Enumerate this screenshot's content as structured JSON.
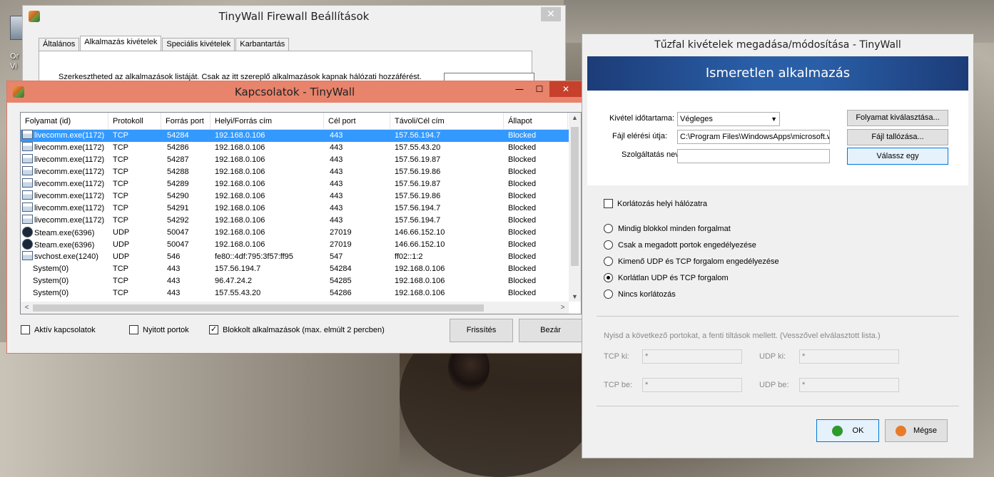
{
  "desktop": {
    "icon_label_line1": "Or",
    "icon_label_line2": "Vi"
  },
  "settings": {
    "title": "TinyWall Firewall Beállítások",
    "close": "✕",
    "tabs": [
      "Általános",
      "Alkalmazás kivételek",
      "Speciális kivételek",
      "Karbantartás"
    ],
    "description": "Szerkesztheted az alkalmazások listáját. Csak az itt szereplő alkalmazások kapnak hálózati hozzáférést."
  },
  "connections": {
    "title": "Kapcsolatok - TinyWall",
    "controls": {
      "minimize": "—",
      "maximize": "☐",
      "close": "✕"
    },
    "columns": [
      "Folyamat (id)",
      "Protokoll",
      "Forrás port",
      "Helyi/Forrás cím",
      "Cél port",
      "Távoli/Cél cím",
      "Állapot"
    ],
    "rows": [
      {
        "icon": "process-icon",
        "proc": "livecomm.exe(1172)",
        "proto": "TCP",
        "src_port": "54284",
        "local": "192.168.0.106",
        "dst_port": "443",
        "remote": "157.56.194.7",
        "state": "Blocked",
        "selected": true
      },
      {
        "icon": "process-icon",
        "proc": "livecomm.exe(1172)",
        "proto": "TCP",
        "src_port": "54286",
        "local": "192.168.0.106",
        "dst_port": "443",
        "remote": "157.55.43.20",
        "state": "Blocked"
      },
      {
        "icon": "process-icon",
        "proc": "livecomm.exe(1172)",
        "proto": "TCP",
        "src_port": "54287",
        "local": "192.168.0.106",
        "dst_port": "443",
        "remote": "157.56.19.87",
        "state": "Blocked"
      },
      {
        "icon": "process-icon",
        "proc": "livecomm.exe(1172)",
        "proto": "TCP",
        "src_port": "54288",
        "local": "192.168.0.106",
        "dst_port": "443",
        "remote": "157.56.19.86",
        "state": "Blocked"
      },
      {
        "icon": "process-icon",
        "proc": "livecomm.exe(1172)",
        "proto": "TCP",
        "src_port": "54289",
        "local": "192.168.0.106",
        "dst_port": "443",
        "remote": "157.56.19.87",
        "state": "Blocked"
      },
      {
        "icon": "process-icon",
        "proc": "livecomm.exe(1172)",
        "proto": "TCP",
        "src_port": "54290",
        "local": "192.168.0.106",
        "dst_port": "443",
        "remote": "157.56.19.86",
        "state": "Blocked"
      },
      {
        "icon": "process-icon",
        "proc": "livecomm.exe(1172)",
        "proto": "TCP",
        "src_port": "54291",
        "local": "192.168.0.106",
        "dst_port": "443",
        "remote": "157.56.194.7",
        "state": "Blocked"
      },
      {
        "icon": "process-icon",
        "proc": "livecomm.exe(1172)",
        "proto": "TCP",
        "src_port": "54292",
        "local": "192.168.0.106",
        "dst_port": "443",
        "remote": "157.56.194.7",
        "state": "Blocked"
      },
      {
        "icon": "steam-icon",
        "proc": "Steam.exe(6396)",
        "proto": "UDP",
        "src_port": "50047",
        "local": "192.168.0.106",
        "dst_port": "27019",
        "remote": "146.66.152.10",
        "state": "Blocked"
      },
      {
        "icon": "steam-icon",
        "proc": "Steam.exe(6396)",
        "proto": "UDP",
        "src_port": "50047",
        "local": "192.168.0.106",
        "dst_port": "27019",
        "remote": "146.66.152.10",
        "state": "Blocked"
      },
      {
        "icon": "process-icon",
        "proc": "svchost.exe(1240)",
        "proto": "UDP",
        "src_port": "546",
        "local": "fe80::4df:795:3f57:ff95",
        "dst_port": "547",
        "remote": "ff02::1:2",
        "state": "Blocked"
      },
      {
        "icon": "none",
        "proc": "System(0)",
        "proto": "TCP",
        "src_port": "443",
        "local": "157.56.194.7",
        "dst_port": "54284",
        "remote": "192.168.0.106",
        "state": "Blocked"
      },
      {
        "icon": "none",
        "proc": "System(0)",
        "proto": "TCP",
        "src_port": "443",
        "local": "96.47.24.2",
        "dst_port": "54285",
        "remote": "192.168.0.106",
        "state": "Blocked"
      },
      {
        "icon": "none",
        "proc": "System(0)",
        "proto": "TCP",
        "src_port": "443",
        "local": "157.55.43.20",
        "dst_port": "54286",
        "remote": "192.168.0.106",
        "state": "Blocked"
      }
    ],
    "filters": {
      "active": {
        "label": "Aktív kapcsolatok",
        "checked": false
      },
      "open_ports": {
        "label": "Nyitott portok",
        "checked": false
      },
      "blocked": {
        "label": "Blokkolt alkalmazások (max. elmúlt 2 percben)",
        "checked": true
      }
    },
    "refresh_label": "Frissítés",
    "close_label": "Bezár"
  },
  "exception": {
    "title": "Tűzfal kivételek megadása/módosítása - TinyWall",
    "banner": "Ismeretlen alkalmazás",
    "duration_label": "Kivétel időtartama:",
    "duration_value": "Végleges",
    "path_label": "Fájl elérési útja:",
    "path_value": "C:\\Program Files\\WindowsApps\\microsoft.w",
    "service_label": "Szolgáltatás neve:",
    "service_value": "",
    "btn_select_process": "Folyamat kiválasztása...",
    "btn_browse": "Fájl tallózása...",
    "btn_choose": "Válassz egy",
    "restrict_local": {
      "label": "Korlátozás helyi hálózatra",
      "checked": false
    },
    "radios": [
      {
        "label": "Mindig blokkol minden forgalmat",
        "checked": false
      },
      {
        "label": "Csak a megadott portok engedélyezése",
        "checked": false
      },
      {
        "label": "Kimenő UDP és TCP forgalom engedélyezése",
        "checked": false
      },
      {
        "label": "Korlátlan UDP és TCP forgalom",
        "checked": true
      },
      {
        "label": "Nincs korlátozás",
        "checked": false
      }
    ],
    "ports_hint": "Nyisd a következő portokat, a fenti tiltások mellett. (Vesszővel elválasztott lista.)",
    "tcp_out_label": "TCP ki:",
    "tcp_out_value": "*",
    "udp_out_label": "UDP ki:",
    "udp_out_value": "*",
    "tcp_in_label": "TCP be:",
    "tcp_in_value": "*",
    "udp_in_label": "UDP be:",
    "udp_in_value": "*",
    "ok_label": "OK",
    "cancel_label": "Mégse",
    "colors": {
      "ok_dot": "#2e9a2e",
      "cancel_dot": "#e87a2a",
      "banner": "#2a5fa8"
    }
  }
}
